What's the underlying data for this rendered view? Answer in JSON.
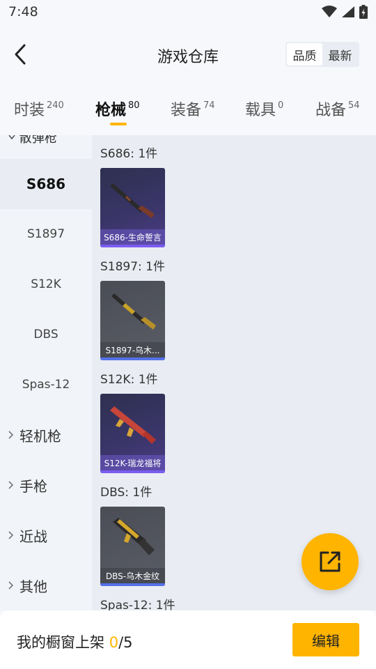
{
  "status": {
    "time": "7:48"
  },
  "header": {
    "title": "游戏仓库",
    "sort": [
      "品质",
      "最新"
    ],
    "sort_active": 0
  },
  "tabs": [
    {
      "label": "时装",
      "count": "240"
    },
    {
      "label": "枪械",
      "count": "80"
    },
    {
      "label": "装备",
      "count": "74"
    },
    {
      "label": "载具",
      "count": "0"
    },
    {
      "label": "战备",
      "count": "54"
    }
  ],
  "sidebar": {
    "cut_group": "散弹枪",
    "items": [
      "S686",
      "S1897",
      "S12K",
      "DBS",
      "Spas-12"
    ],
    "groups": [
      "轻机枪",
      "手枪",
      "近战",
      "其他"
    ]
  },
  "content": {
    "sections": [
      {
        "title": "S686: 1件",
        "item": "S686-生命誓言",
        "rarity": "purple"
      },
      {
        "title": "S1897: 1件",
        "item": "S1897-乌木...",
        "rarity": "gray"
      },
      {
        "title": "S12K: 1件",
        "item": "S12K-瑞龙福将",
        "rarity": "purple"
      },
      {
        "title": "DBS: 1件",
        "item": "DBS-乌木金纹",
        "rarity": "gray"
      },
      {
        "title": "Spas-12: 1件"
      }
    ]
  },
  "bottom": {
    "label": "我的橱窗上架",
    "current": "0",
    "total": "/5",
    "edit": "编辑"
  },
  "colors": {
    "accent": "#ffb400",
    "purple_rarity": "#7b5cf0"
  }
}
